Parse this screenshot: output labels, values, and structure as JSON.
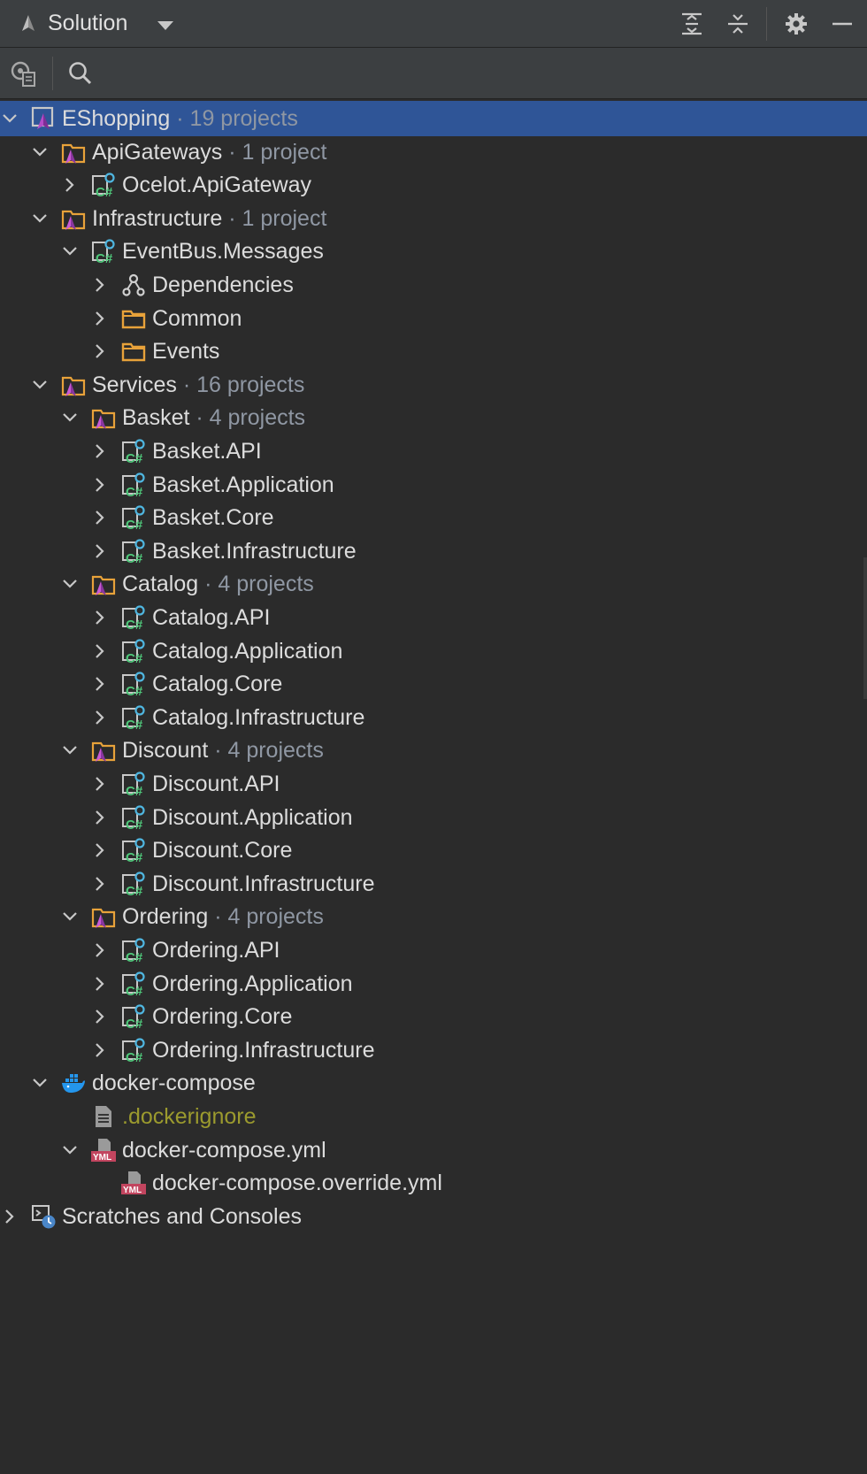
{
  "window": {
    "title": "Solution"
  },
  "toolbar": {
    "icons": [
      "expand-all-icon",
      "collapse-all-icon",
      "settings-icon",
      "minimize-icon",
      "locate-file-icon",
      "search-icon"
    ]
  },
  "tree": [
    {
      "name": "EShopping",
      "count": " · 19 projects",
      "icon": "solution",
      "level": 0,
      "state": "expanded",
      "selected": true
    },
    {
      "name": "ApiGateways",
      "count": " · 1 project",
      "icon": "solution-folder",
      "level": 1,
      "state": "expanded"
    },
    {
      "name": "Ocelot.ApiGateway",
      "count": "",
      "icon": "csharp-project",
      "level": 2,
      "state": "collapsed"
    },
    {
      "name": "Infrastructure",
      "count": " · 1 project",
      "icon": "solution-folder",
      "level": 1,
      "state": "expanded"
    },
    {
      "name": "EventBus.Messages",
      "count": "",
      "icon": "csharp-project",
      "level": 2,
      "state": "expanded"
    },
    {
      "name": "Dependencies",
      "count": "",
      "icon": "dependencies",
      "level": 3,
      "state": "collapsed"
    },
    {
      "name": "Common",
      "count": "",
      "icon": "folder",
      "level": 3,
      "state": "collapsed"
    },
    {
      "name": "Events",
      "count": "",
      "icon": "folder",
      "level": 3,
      "state": "collapsed"
    },
    {
      "name": "Services",
      "count": " · 16 projects",
      "icon": "solution-folder",
      "level": 1,
      "state": "expanded"
    },
    {
      "name": "Basket",
      "count": " · 4 projects",
      "icon": "solution-folder",
      "level": 2,
      "state": "expanded"
    },
    {
      "name": "Basket.API",
      "count": "",
      "icon": "csharp-project",
      "level": 3,
      "state": "collapsed"
    },
    {
      "name": "Basket.Application",
      "count": "",
      "icon": "csharp-project",
      "level": 3,
      "state": "collapsed"
    },
    {
      "name": "Basket.Core",
      "count": "",
      "icon": "csharp-project",
      "level": 3,
      "state": "collapsed"
    },
    {
      "name": "Basket.Infrastructure",
      "count": "",
      "icon": "csharp-project",
      "level": 3,
      "state": "collapsed"
    },
    {
      "name": "Catalog",
      "count": " · 4 projects",
      "icon": "solution-folder",
      "level": 2,
      "state": "expanded"
    },
    {
      "name": "Catalog.API",
      "count": "",
      "icon": "csharp-project",
      "level": 3,
      "state": "collapsed"
    },
    {
      "name": "Catalog.Application",
      "count": "",
      "icon": "csharp-project",
      "level": 3,
      "state": "collapsed"
    },
    {
      "name": "Catalog.Core",
      "count": "",
      "icon": "csharp-project",
      "level": 3,
      "state": "collapsed"
    },
    {
      "name": "Catalog.Infrastructure",
      "count": "",
      "icon": "csharp-project",
      "level": 3,
      "state": "collapsed"
    },
    {
      "name": "Discount",
      "count": " · 4 projects",
      "icon": "solution-folder",
      "level": 2,
      "state": "expanded"
    },
    {
      "name": "Discount.API",
      "count": "",
      "icon": "csharp-project",
      "level": 3,
      "state": "collapsed"
    },
    {
      "name": "Discount.Application",
      "count": "",
      "icon": "csharp-project",
      "level": 3,
      "state": "collapsed"
    },
    {
      "name": "Discount.Core",
      "count": "",
      "icon": "csharp-project",
      "level": 3,
      "state": "collapsed"
    },
    {
      "name": "Discount.Infrastructure",
      "count": "",
      "icon": "csharp-project",
      "level": 3,
      "state": "collapsed"
    },
    {
      "name": "Ordering",
      "count": " · 4 projects",
      "icon": "solution-folder",
      "level": 2,
      "state": "expanded"
    },
    {
      "name": "Ordering.API",
      "count": "",
      "icon": "csharp-project",
      "level": 3,
      "state": "collapsed"
    },
    {
      "name": "Ordering.Application",
      "count": "",
      "icon": "csharp-project",
      "level": 3,
      "state": "collapsed"
    },
    {
      "name": "Ordering.Core",
      "count": "",
      "icon": "csharp-project",
      "level": 3,
      "state": "collapsed"
    },
    {
      "name": "Ordering.Infrastructure",
      "count": "",
      "icon": "csharp-project",
      "level": 3,
      "state": "collapsed"
    },
    {
      "name": "docker-compose",
      "count": "",
      "icon": "docker",
      "level": 1,
      "state": "expanded"
    },
    {
      "name": ".dockerignore",
      "count": "",
      "icon": "text-file",
      "level": 2,
      "state": "none",
      "style": "gitignore"
    },
    {
      "name": "docker-compose.yml",
      "count": "",
      "icon": "yaml-file",
      "level": 2,
      "state": "expanded"
    },
    {
      "name": "docker-compose.override.yml",
      "count": "",
      "icon": "yaml-file",
      "level": 3,
      "state": "none"
    },
    {
      "name": "Scratches and Consoles",
      "count": "",
      "icon": "scratches",
      "level": 0,
      "state": "collapsed"
    }
  ],
  "colors": {
    "background": "#2b2b2b",
    "header": "#3c3f41",
    "selection": "#2f5597",
    "text": "#dcdcdc",
    "count_text": "#8f97a3",
    "folder_orange": "#e8a23a",
    "csharp_green": "#4fc77a",
    "docker_blue": "#2496ed",
    "yaml_red": "#c2455f",
    "ignored_text": "#9b9a2e"
  }
}
